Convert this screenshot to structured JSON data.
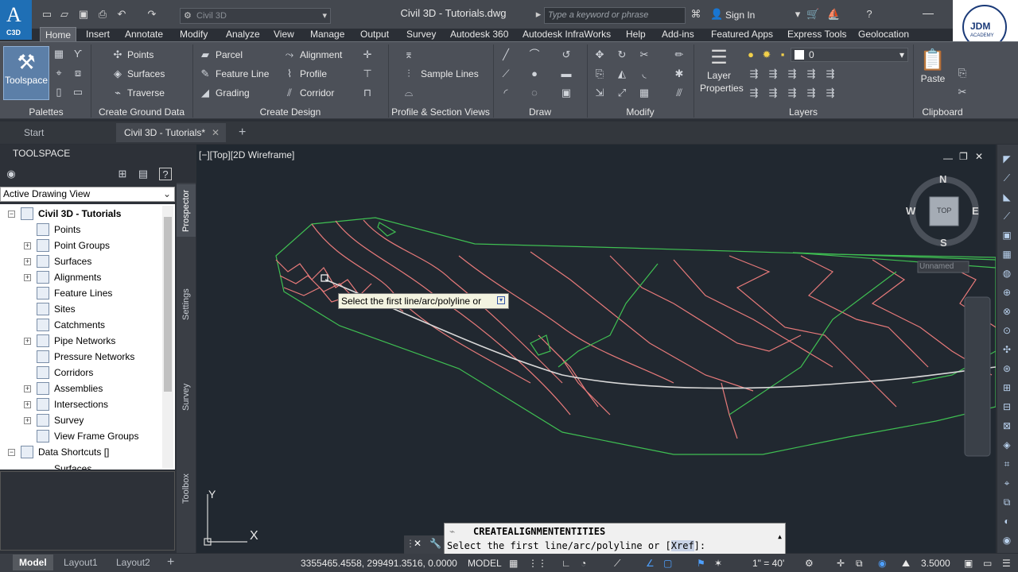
{
  "app": {
    "logo_letter": "A",
    "logo_sub": "C3D",
    "workspace": "Civil 3D",
    "title": "Civil 3D - Tutorials.dwg",
    "search_placeholder": "Type a keyword or phrase",
    "sign_in": "Sign In",
    "jdm_logo": "JDM",
    "jdm_sub": "ACADEMY"
  },
  "menu": [
    {
      "label": "Home",
      "active": true
    },
    {
      "label": "Insert"
    },
    {
      "label": "Annotate"
    },
    {
      "label": "Modify"
    },
    {
      "label": "Analyze"
    },
    {
      "label": "View"
    },
    {
      "label": "Manage"
    },
    {
      "label": "Output"
    },
    {
      "label": "Survey"
    },
    {
      "label": "Autodesk 360"
    },
    {
      "label": "Autodesk InfraWorks"
    },
    {
      "label": "Help"
    },
    {
      "label": "Add-ins"
    },
    {
      "label": "Featured Apps"
    },
    {
      "label": "Express Tools"
    },
    {
      "label": "Geolocation"
    }
  ],
  "ribbon": {
    "toolspace_label": "Toolspace",
    "ground_data": [
      "Points",
      "Surfaces",
      "Traverse"
    ],
    "design_col1": [
      "Parcel",
      "Feature Line",
      "Grading"
    ],
    "design_col2": [
      "Alignment",
      "Profile",
      "Corridor"
    ],
    "sample_lines": "Sample Lines",
    "layer_properties_1": "Layer",
    "layer_properties_2": "Properties",
    "layer_current": "0",
    "paste": "Paste",
    "panels": [
      "Palettes",
      "Create Ground Data",
      "Create Design",
      "Profile & Section Views",
      "Draw",
      "Modify",
      "Layers",
      "Clipboard"
    ]
  },
  "doctabs": [
    "Start",
    "Civil 3D - Tutorials*"
  ],
  "toolspace": {
    "title": "TOOLSPACE",
    "view": "Active Drawing View",
    "root": "Civil 3D - Tutorials",
    "items": [
      "Points",
      "Point Groups",
      "Surfaces",
      "Alignments",
      "Feature Lines",
      "Sites",
      "Catchments",
      "Pipe Networks",
      "Pressure Networks",
      "Corridors",
      "Assemblies",
      "Intersections",
      "Survey",
      "View Frame Groups"
    ],
    "data_shortcuts": "Data Shortcuts []",
    "partial_item": "Surfaces",
    "side_tabs": [
      "Prospector",
      "Settings",
      "Survey",
      "Toolbox"
    ]
  },
  "viewport": {
    "label": "[−][Top][2D Wireframe]",
    "tooltip": "Select the first line/arc/polyline or",
    "compass": {
      "n": "N",
      "s": "S",
      "e": "E",
      "w": "W",
      "top": "TOP"
    },
    "ucs_name": "Unnamed",
    "axis_x": "X",
    "axis_y": "Y"
  },
  "command": {
    "name": "CREATEALIGNMENTENTITIES",
    "prompt_prefix": "Select the first line/arc/polyline or [",
    "prompt_option": "Xref",
    "prompt_suffix": "]:"
  },
  "status": {
    "coords": "3355465.4558, 299491.3516, 0.0000",
    "model": "MODEL",
    "scale": "1\" = 40'",
    "value": "3.5000",
    "layout_tabs": [
      "Model",
      "Layout1",
      "Layout2"
    ]
  }
}
